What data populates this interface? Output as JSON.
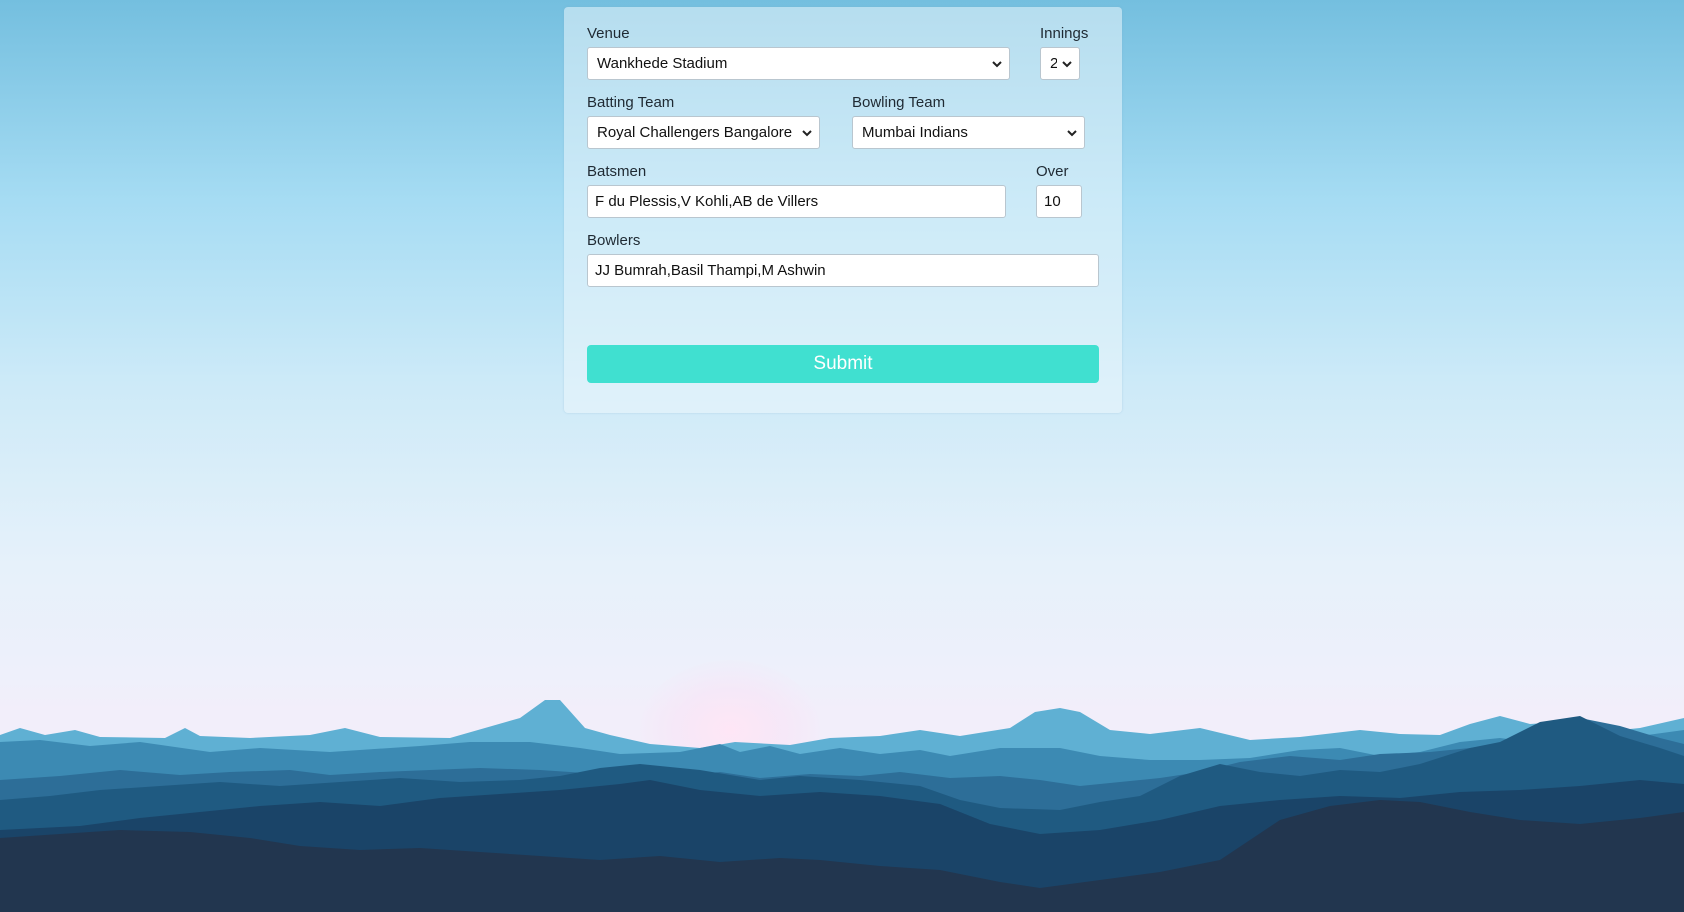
{
  "form": {
    "venue": {
      "label": "Venue",
      "value": "Wankhede Stadium"
    },
    "innings": {
      "label": "Innings",
      "value": "2"
    },
    "batting_team": {
      "label": "Batting Team",
      "value": "Royal Challengers Bangalore"
    },
    "bowling_team": {
      "label": "Bowling Team",
      "value": "Mumbai Indians"
    },
    "batsmen": {
      "label": "Batsmen",
      "value": "F du Plessis,V Kohli,AB de Villers"
    },
    "over": {
      "label": "Over",
      "value": "10"
    },
    "bowlers": {
      "label": "Bowlers",
      "value": "JJ Bumrah,Basil Thampi,M Ashwin"
    },
    "submit_label": "Submit"
  },
  "colors": {
    "submit_button": "#40e0d0",
    "sky_top": "#74bfdf",
    "mountain_dark": "#22364f"
  },
  "icons": {
    "select_arrow": "chevron-down-icon"
  }
}
